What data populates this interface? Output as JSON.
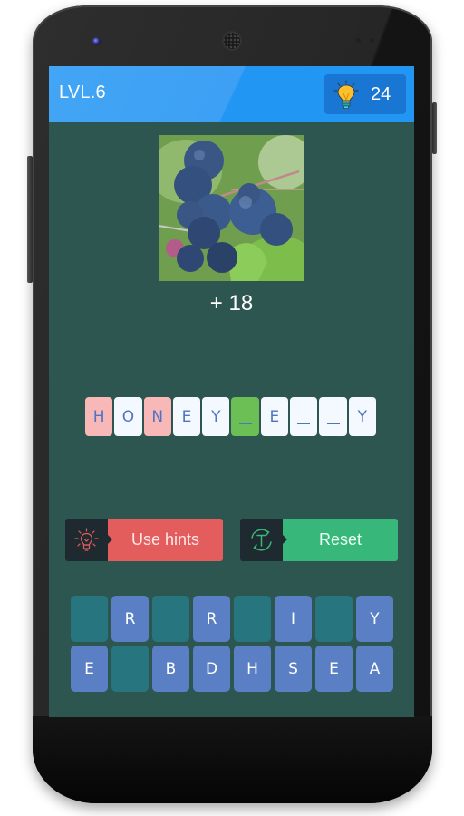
{
  "header": {
    "level_label": "LVL.6",
    "hint_count": "24",
    "hint_icon": "lightbulb-icon"
  },
  "puzzle": {
    "image_subject": "serviceberries on a branch",
    "score_label": "+ 18"
  },
  "answer": {
    "tiles": [
      {
        "char": "H",
        "state": "hinted"
      },
      {
        "char": "O",
        "state": "filled"
      },
      {
        "char": "N",
        "state": "hinted"
      },
      {
        "char": "E",
        "state": "filled"
      },
      {
        "char": "Y",
        "state": "filled"
      },
      {
        "char": "",
        "state": "active"
      },
      {
        "char": "E",
        "state": "filled"
      },
      {
        "char": "",
        "state": "empty"
      },
      {
        "char": "",
        "state": "empty"
      },
      {
        "char": "Y",
        "state": "filled"
      }
    ]
  },
  "actions": {
    "hints_label": "Use hints",
    "reset_label": "Reset"
  },
  "keyboard": {
    "rows": [
      [
        {
          "char": "",
          "used": true
        },
        {
          "char": "R",
          "used": false
        },
        {
          "char": "",
          "used": true
        },
        {
          "char": "R",
          "used": false
        },
        {
          "char": "",
          "used": true
        },
        {
          "char": "I",
          "used": false
        },
        {
          "char": "",
          "used": true
        },
        {
          "char": "Y",
          "used": false
        }
      ],
      [
        {
          "char": "E",
          "used": false
        },
        {
          "char": "",
          "used": true
        },
        {
          "char": "B",
          "used": false
        },
        {
          "char": "D",
          "used": false
        },
        {
          "char": "H",
          "used": false
        },
        {
          "char": "S",
          "used": false
        },
        {
          "char": "E",
          "used": false
        },
        {
          "char": "A",
          "used": false
        }
      ]
    ]
  },
  "colors": {
    "header": "#2196f3",
    "hint_badge": "#1976d2",
    "background": "#2d5650",
    "hint_tile": "#f8b8b8",
    "active_tile": "#6bbf55",
    "hints_button": "#e35d5d",
    "reset_button": "#37b87a",
    "key": "#5a7fc5",
    "used_key": "#27767f"
  }
}
